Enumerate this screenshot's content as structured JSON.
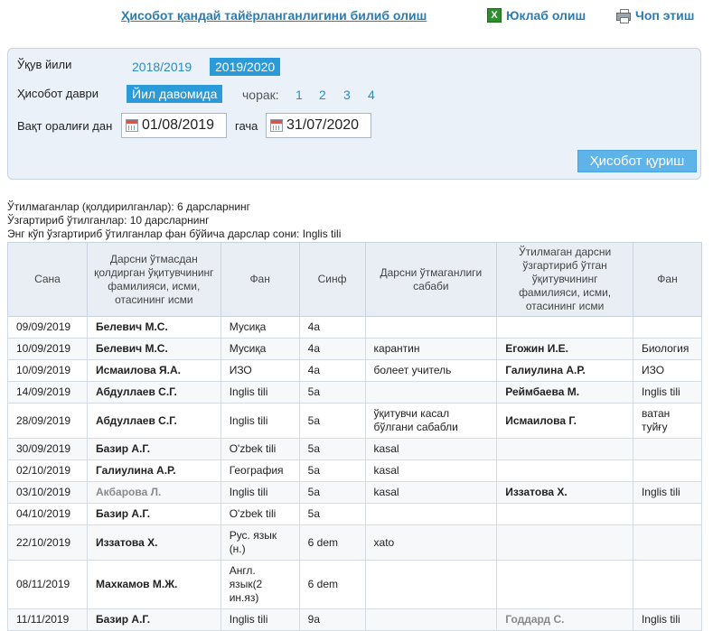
{
  "header": {
    "help_link": "Ҳисобот қандай тайёрланганлигини билиб олиш",
    "excel_label": "Юклаб олиш",
    "print_label": "Чоп этиш"
  },
  "filters": {
    "year_label": "Ўқув йили",
    "years": [
      "2018/2019",
      "2019/2020"
    ],
    "selected_year": "2019/2020",
    "period_label": "Ҳисобот даври",
    "period_selected": "Йил давомида",
    "quarter_label": "чорак:",
    "quarters": [
      "1",
      "2",
      "3",
      "4"
    ],
    "range_label": "Вақт оралиғи дан",
    "date_from": "01/08/2019",
    "to_label": "гача",
    "date_to": "31/07/2020",
    "build_button": "Ҳисобот қуриш"
  },
  "summary": {
    "line1": "Ўтилмаганлар (қолдирилганлар): 6 дарсларнинг",
    "line2": "Ўзгартириб ўтилганлар: 10 дарсларнинг",
    "line3": "Энг кўп ўзгартириб ўтилганлар фан бўйича дарслар сони: Inglis tili"
  },
  "table": {
    "headers": [
      "Сана",
      "Дарсни ўтмасдан қолдирган ўқитувчининг фамилияси, исми, отасининг исми",
      "Фан",
      "Синф",
      "Дарсни ўтмаганлиги сабаби",
      "Ўтилмаган дарсни ўзгартириб ўтган ўқитувчининг фамилияси, исми, отасининг исми",
      "Фан"
    ],
    "rows": [
      {
        "date": "09/09/2019",
        "teacher": "Белевич М.С.",
        "subject": "Мусиқа",
        "class": "4a",
        "reason": "",
        "substitute": "",
        "sub_subject": ""
      },
      {
        "date": "10/09/2019",
        "teacher": "Белевич М.С.",
        "subject": "Мусиқа",
        "class": "4a",
        "reason": "карантин",
        "substitute": "Егожин И.Е.",
        "sub_subject": "Биология"
      },
      {
        "date": "10/09/2019",
        "teacher": "Исмаилова Я.А.",
        "subject": "ИЗО",
        "class": "4a",
        "reason": "болеет учитель",
        "substitute": "Галиулина А.Р.",
        "sub_subject": "ИЗО"
      },
      {
        "date": "14/09/2019",
        "teacher": "Абдуллаев С.Г.",
        "subject": "Inglis tili",
        "class": "5a",
        "reason": "",
        "substitute": "Реймбаева М.",
        "sub_subject": "Inglis tili"
      },
      {
        "date": "28/09/2019",
        "teacher": "Абдуллаев С.Г.",
        "subject": "Inglis tili",
        "class": "5a",
        "reason": "ўқитувчи касал бўлгани сабабли",
        "substitute": "Исмаилова Г.",
        "sub_subject": "ватан туйғу"
      },
      {
        "date": "30/09/2019",
        "teacher": "Базир А.Г.",
        "subject": "O'zbek tili",
        "class": "5a",
        "reason": "kasal",
        "substitute": "",
        "sub_subject": ""
      },
      {
        "date": "02/10/2019",
        "teacher": "Галиулина А.Р.",
        "subject": "География",
        "class": "5a",
        "reason": "kasal",
        "substitute": "",
        "sub_subject": ""
      },
      {
        "date": "03/10/2019",
        "teacher": "Акбарова Л.",
        "subject": "Inglis tili",
        "class": "5a",
        "reason": "kasal",
        "substitute": "Иззатова Х.",
        "sub_subject": "Inglis tili"
      },
      {
        "date": "04/10/2019",
        "teacher": "Базир А.Г.",
        "subject": "O'zbek tili",
        "class": "5a",
        "reason": "",
        "substitute": "",
        "sub_subject": ""
      },
      {
        "date": "22/10/2019",
        "teacher": "Иззатова Х.",
        "subject": "Рус. язык (н.)",
        "class": "6 dem",
        "reason": "xato",
        "substitute": "",
        "sub_subject": ""
      },
      {
        "date": "08/11/2019",
        "teacher": "Махкамов М.Ж.",
        "subject": "Англ. язык(2 ин.яз)",
        "class": "6 dem",
        "reason": "",
        "substitute": "",
        "sub_subject": ""
      },
      {
        "date": "11/11/2019",
        "teacher": "Базир А.Г.",
        "subject": "Inglis tili",
        "class": "9a",
        "reason": "",
        "substitute": "Годдард С.",
        "sub_subject": "Inglis tili"
      }
    ]
  }
}
